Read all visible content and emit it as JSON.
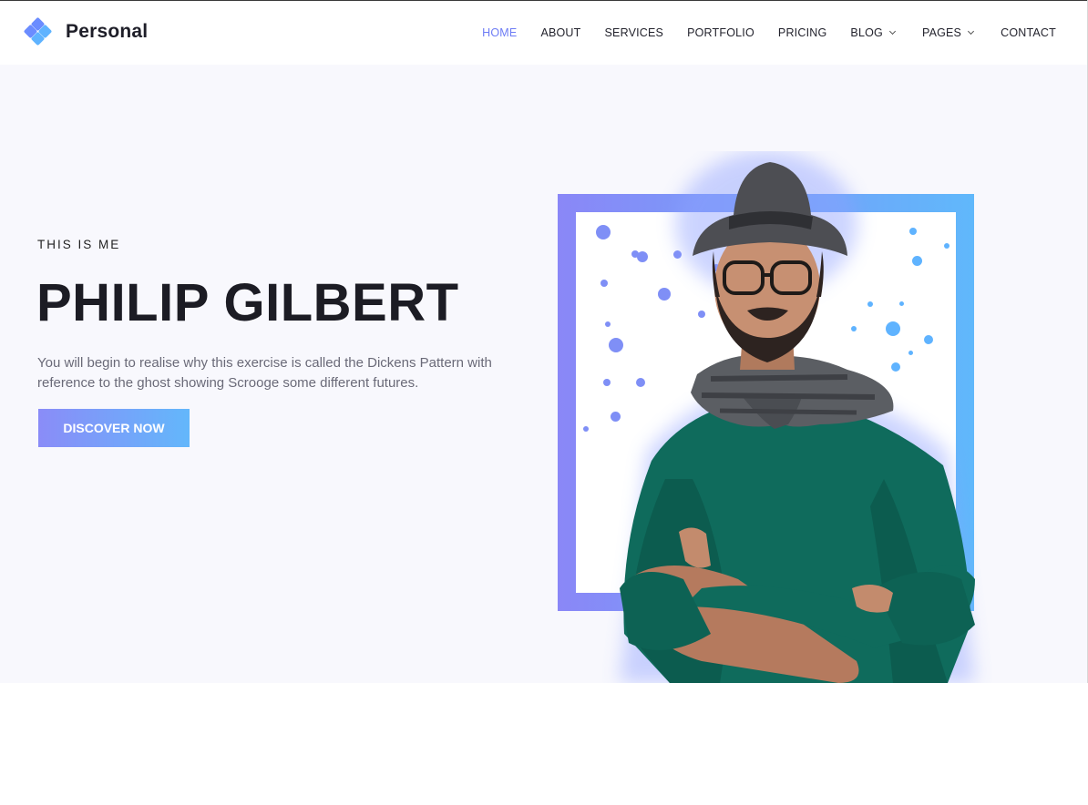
{
  "brand": {
    "name": "Personal"
  },
  "nav": {
    "items": [
      {
        "label": "HOME"
      },
      {
        "label": "ABOUT"
      },
      {
        "label": "SERVICES"
      },
      {
        "label": "PORTFOLIO"
      },
      {
        "label": "PRICING"
      },
      {
        "label": "BLOG"
      },
      {
        "label": "PAGES"
      },
      {
        "label": "CONTACT"
      }
    ]
  },
  "hero": {
    "eyebrow": "THIS IS ME",
    "name": "PHILIP GILBERT",
    "description": "You will begin to realise why this exercise is called the Dickens Pattern with reference to the ghost showing Scrooge some different futures.",
    "cta_label": "DISCOVER NOW"
  },
  "colors": {
    "accent": "#6d7cf5",
    "gradient_start": "#8a8cf8",
    "gradient_end": "#63b7fb",
    "hero_bg": "#f8f8fd",
    "sweater": "#0f6b5c"
  },
  "icons": {
    "logo": "diamond-cluster-icon",
    "dropdown": "chevron-down-icon"
  }
}
